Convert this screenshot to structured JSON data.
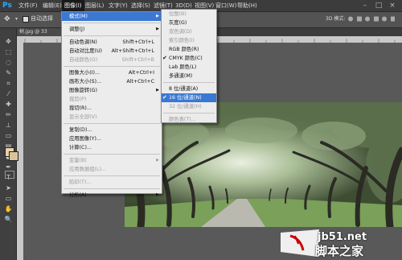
{
  "app": {
    "logo": "Ps"
  },
  "menubar": {
    "items": [
      "文件(F)",
      "编辑(E)",
      "图像(I)",
      "图层(L)",
      "文字(Y)",
      "选择(S)",
      "滤镜(T)",
      "3D(D)",
      "视图(V)",
      "窗口(W)",
      "帮助(H)"
    ],
    "window_buttons": [
      "–",
      "□",
      "×"
    ]
  },
  "options": {
    "auto_select_label": "自动选择",
    "mode_label": "3D 模式:"
  },
  "document": {
    "tab_label": "树.jpg @ 33"
  },
  "image_menu": {
    "items": [
      {
        "label": "模式(M)",
        "shortcut": "",
        "submenu": true,
        "highlight": true
      },
      {
        "sep": true
      },
      {
        "label": "调整(J)",
        "shortcut": "",
        "submenu": true
      },
      {
        "sep": true
      },
      {
        "label": "自动色调(N)",
        "shortcut": "Shift+Ctrl+L"
      },
      {
        "label": "自动对比度(U)",
        "shortcut": "Alt+Shift+Ctrl+L"
      },
      {
        "label": "自动颜色(O)",
        "shortcut": "Shift+Ctrl+B",
        "disabled": true
      },
      {
        "sep": true
      },
      {
        "label": "图像大小(I)...",
        "shortcut": "Alt+Ctrl+I"
      },
      {
        "label": "画布大小(S)...",
        "shortcut": "Alt+Ctrl+C"
      },
      {
        "label": "图像旋转(G)",
        "shortcut": "",
        "submenu": true
      },
      {
        "label": "裁剪(P)",
        "shortcut": "",
        "disabled": true
      },
      {
        "label": "裁切(R)...",
        "shortcut": ""
      },
      {
        "label": "显示全部(V)",
        "shortcut": "",
        "disabled": true
      },
      {
        "sep": true
      },
      {
        "label": "复制(D)...",
        "shortcut": ""
      },
      {
        "label": "应用图像(Y)...",
        "shortcut": ""
      },
      {
        "label": "计算(C)...",
        "shortcut": ""
      },
      {
        "sep": true
      },
      {
        "label": "变量(B)",
        "shortcut": "",
        "submenu": true,
        "disabled": true
      },
      {
        "label": "应用数据组(L)...",
        "shortcut": "",
        "disabled": true
      },
      {
        "sep": true
      },
      {
        "label": "陷印(T)...",
        "shortcut": "",
        "disabled": true
      },
      {
        "sep": true
      },
      {
        "label": "分析(A)",
        "shortcut": "",
        "submenu": true
      }
    ]
  },
  "mode_menu": {
    "items": [
      {
        "label": "位图(B)",
        "disabled": true
      },
      {
        "label": "灰度(G)"
      },
      {
        "label": "双色调(D)",
        "disabled": true
      },
      {
        "label": "索引颜色(I)",
        "disabled": true
      },
      {
        "label": "RGB 颜色(R)"
      },
      {
        "label": "CMYK 颜色(C)",
        "checked": true
      },
      {
        "label": "Lab 颜色(L)"
      },
      {
        "label": "多通道(M)"
      },
      {
        "sep": true
      },
      {
        "label": "8 位/通道(A)"
      },
      {
        "label": "16 位/通道(N)",
        "checked": true,
        "highlight": true
      },
      {
        "label": "32 位/通道(H)",
        "disabled": true
      },
      {
        "sep": true
      },
      {
        "label": "颜色表(T)...",
        "disabled": true
      }
    ]
  },
  "watermark": {
    "line1": "jb51.net",
    "line2": "脚本之家"
  },
  "colors": {
    "accent": "#3a78d4",
    "ps_blue": "#31a8ff",
    "menu_bg": "#ececec"
  }
}
